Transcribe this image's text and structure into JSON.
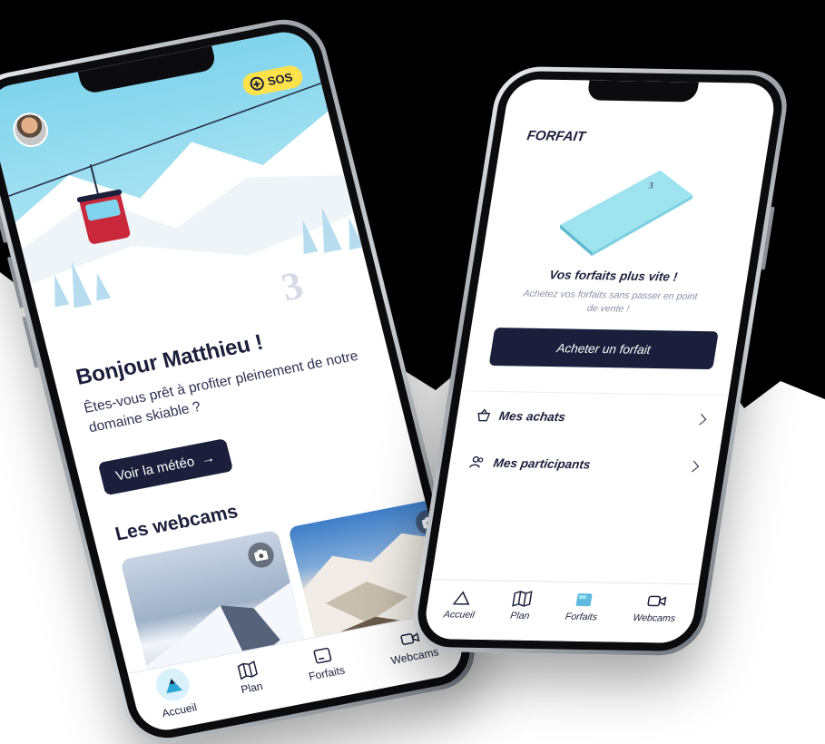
{
  "colors": {
    "brand_navy": "#1b1f3b",
    "sos_yellow": "#ffe14a",
    "sky_blue": "#7fd3ec",
    "gondola_red": "#c8283a",
    "card_cyan": "#9fe3f0"
  },
  "home": {
    "sos_label": "SOS",
    "greeting_title": "Bonjour Matthieu !",
    "greeting_text": "Êtes-vous prêt à profiter pleinement de notre domaine skiable ?",
    "weather_button": "Voir la météo",
    "webcams_title": "Les webcams",
    "tabs": [
      {
        "label": "Accueil",
        "icon": "mountain-icon",
        "active": true
      },
      {
        "label": "Plan",
        "icon": "map-icon",
        "active": false
      },
      {
        "label": "Forfaits",
        "icon": "ski-pass-icon",
        "active": false
      },
      {
        "label": "Webcams",
        "icon": "video-camera-icon",
        "active": false
      }
    ]
  },
  "forfait": {
    "title": "FORFAIT",
    "promo_title": "Vos forfaits plus vite !",
    "promo_subtitle": "Achetez vos forfaits sans passer en point de vente !",
    "buy_button": "Acheter un forfait",
    "menu": [
      {
        "label": "Mes achats",
        "icon": "basket-icon"
      },
      {
        "label": "Mes participants",
        "icon": "users-icon"
      }
    ],
    "tabs": [
      {
        "label": "Accueil",
        "icon": "mountain-icon",
        "active": false
      },
      {
        "label": "Plan",
        "icon": "map-icon",
        "active": false
      },
      {
        "label": "Forfaits",
        "icon": "ski-pass-icon",
        "active": true
      },
      {
        "label": "Webcams",
        "icon": "video-camera-icon",
        "active": false
      }
    ]
  }
}
